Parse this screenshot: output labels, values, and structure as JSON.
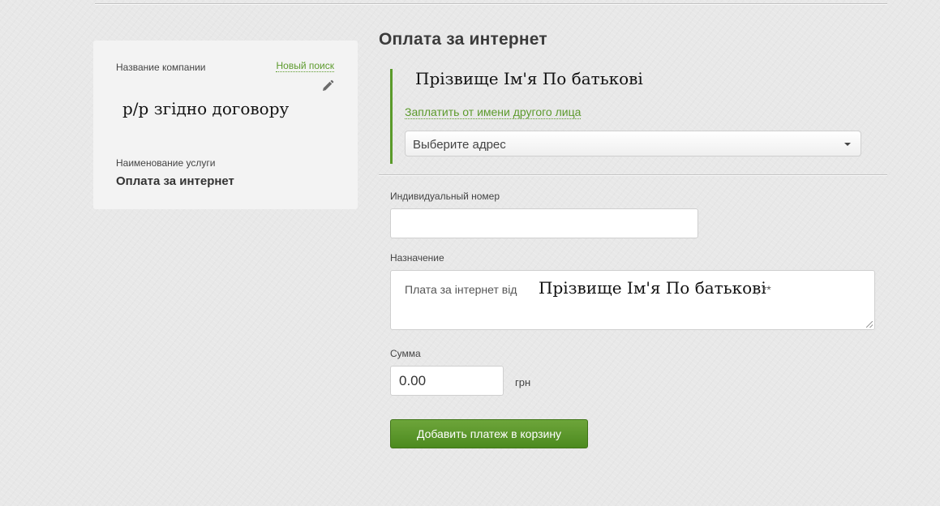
{
  "sidebar": {
    "company_label": "Название компании",
    "new_search_label": "Новый поиск",
    "company_value": "р/р згідно договору",
    "service_label": "Наименование услуги",
    "service_value": "Оплата за интернет"
  },
  "main": {
    "title": "Оплата за интернет",
    "payer_name": "Прізвище Ім'я По батькові",
    "pay_other_link": "Заплатить от имени другого лица",
    "address_select": {
      "selected": "Выберите адрес"
    },
    "individual_number": {
      "label": "Индивидуальный номер",
      "value": ""
    },
    "purpose": {
      "label": "Назначение",
      "prefix": "Плата за інтернет від",
      "name": "Прізвище Ім'я По батькові",
      "suffix": ", **"
    },
    "amount": {
      "label": "Сумма",
      "value": "0.00",
      "currency": "грн"
    },
    "add_button_label": "Добавить платеж в корзину"
  },
  "colors": {
    "accent_green": "#5a9a2a",
    "button_green": "#4c8a1f",
    "link_green": "#5c9a2c"
  },
  "icons": [
    "pencil-icon",
    "chevron-down-icon",
    "resize-handle-icon"
  ]
}
